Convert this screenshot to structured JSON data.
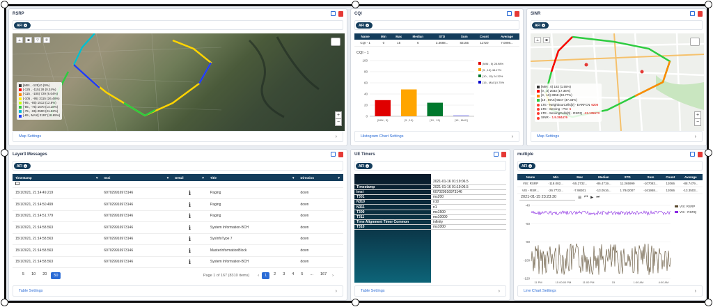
{
  "rsrp": {
    "title": "RSRP",
    "afi": "AFI",
    "legend": [
      {
        "label": "[MIN , -125) 0 (0%)",
        "color": "#333333"
      },
      {
        "label": "[-125 , -115) 28 (0.24%)",
        "color": "#ff0000"
      },
      {
        "label": "[-115 , -105) 729 (6.04%)",
        "color": "#ff8a00"
      },
      {
        "label": "[-105 , -95) 3115 (26.48%)",
        "color": "#ffee00"
      },
      {
        "label": "[-95 , -85) 1512 (12.8%)",
        "color": "#c8ff00"
      },
      {
        "label": "[-85 , -75) 1670 (14.18%)",
        "color": "#2ecc40"
      },
      {
        "label": "[-75 , -65) 2500 (21.22%)",
        "color": "#00bcd4"
      },
      {
        "label": "[-65 , MAX] 2197 (18.65%)",
        "color": "#1e3cff"
      }
    ],
    "footer": "Map Settings"
  },
  "cqi": {
    "title": "CQI",
    "afi": "AFI",
    "stats_headers": [
      "Name",
      "Min",
      "Max",
      "Median",
      "STD",
      "Sum",
      "Count",
      "Average"
    ],
    "stats_rows": [
      [
        "CQI - 1",
        "0",
        "15",
        "6",
        "3.3688...",
        "82155",
        "11720",
        "7.0098..."
      ]
    ],
    "chart_title": "CQI - 1",
    "footer": "Histogram Chart Settings"
  },
  "chart_data": {
    "type": "bar",
    "categories": [
      "[MIN , 5)",
      "[5 , 10)",
      "[10 , 15)",
      "[15 , MAX]"
    ],
    "values": [
      28.98,
      48.17,
      24.32,
      0.75
    ],
    "ylim": [
      0,
      100
    ],
    "yticks": [
      0,
      20,
      40,
      60,
      80,
      100
    ],
    "colors": [
      "#e00000",
      "#ffa500",
      "#00782d",
      "#0000cc"
    ],
    "legend": [
      "[MIN , 5) 28.98%",
      "[5 , 10) 48.17%",
      "[10 , 15) 24.32%",
      "[15 , MAX] 0.75%"
    ],
    "legend_position": "top-right"
  },
  "sinr": {
    "title": "SINR",
    "afi": "AFI",
    "legend": [
      {
        "label": "[MIN , 0) 182 (1.55%)",
        "color": "#333333"
      },
      {
        "label": "[0 , 3) 2033 (17.35%)",
        "color": "#ff0000"
      },
      {
        "label": "[3 , 10) 3958 (33.77%)",
        "color": "#ff8a00"
      },
      {
        "label": "[10 , MAX] 5547 (47.33%)",
        "color": "#2ecc40"
      }
    ],
    "info": [
      {
        "label": "LTE - NeighbourCells[0] - EARFCN",
        "value": "6200",
        "color": "#ff3b30"
      },
      {
        "label": "LTE - Serving - PCI",
        "value": "5",
        "color": "#ff3b30"
      },
      {
        "label": "LTE - ServingCells[0] - RSRQ",
        "value": "-13.135573",
        "color": "#ff3b30"
      },
      {
        "label": "SINR -",
        "value": "1.9.384476",
        "color": "#ff3b30"
      }
    ],
    "footer": "Map Settings"
  },
  "layer3": {
    "title": "Layer3 Messages",
    "afi": "AFI",
    "headers": [
      "Timestamp",
      "Imsi",
      "Detail",
      "Title",
      "Direction"
    ],
    "rows": [
      [
        "15/1/2021, 21:14:49.219",
        "607029916973146",
        "i",
        "Paging",
        "down"
      ],
      [
        "15/1/2021, 21:14:50.499",
        "607029916973146",
        "i",
        "Paging",
        "down"
      ],
      [
        "15/1/2021, 21:14:51.779",
        "607029916973146",
        "i",
        "Paging",
        "down"
      ],
      [
        "15/1/2021, 21:14:58.563",
        "607029916973146",
        "i",
        "System Information-BCH",
        "down"
      ],
      [
        "15/1/2021, 21:14:58.563",
        "607029916973146",
        "i",
        "SysInfoType 7",
        "down"
      ],
      [
        "15/1/2021, 21:14:58.563",
        "607029916973146",
        "i",
        "MasterInformationBlock",
        "down"
      ],
      [
        "15/1/2021, 21:14:58.563",
        "607029916973146",
        "i",
        "System Information-BCH",
        "down"
      ]
    ],
    "page_sizes": [
      "5",
      "10",
      "20",
      "50"
    ],
    "page_size_selected": "50",
    "page_info": "Page 1 of 167 (8310 items)",
    "pages": [
      "1",
      "2",
      "3",
      "4",
      "5",
      "...",
      "167"
    ],
    "footer": "Table Settings"
  },
  "ue_timers": {
    "title": "UE Timers",
    "afi": "AFI",
    "rows": [
      [
        "",
        "2021-01-16 01:19:06.5"
      ],
      [
        "Timestamp",
        "2021-01-16 01:19:06.5"
      ],
      [
        "Imsi",
        "607029916973146"
      ],
      [
        "T301",
        "ms200"
      ],
      [
        "N310",
        "n10"
      ],
      [
        "N311",
        "n1"
      ],
      [
        "T300",
        "ms1500"
      ],
      [
        "T311",
        "ms10000"
      ],
      [
        "Time Alignment Timer Common",
        "infinity"
      ],
      [
        "T310",
        "ms1000"
      ]
    ],
    "footer": "Table Settings"
  },
  "multiple": {
    "title": "multiple",
    "afi": "AFI",
    "stats_headers": [
      "Name",
      "Min",
      "Max",
      "Median",
      "STD",
      "Sum",
      "Count",
      "Average"
    ],
    "stats_rows": [
      [
        "VIS: RSRP",
        "-118.082...",
        "-55.2732...",
        "-86.4719...",
        "11.265999",
        "-107083...",
        "12066",
        "-88.7479..."
      ],
      [
        "VIS - RSR...",
        "-26.7733...",
        "-7.98301",
        "-13.0516...",
        "1.7842007",
        "-161958...",
        "12066",
        "-13.3503..."
      ]
    ],
    "time_value": "2021-01-15 23:23:30",
    "legend": [
      "VIS: RSRP",
      "VIS - RSRQ"
    ],
    "series_colors": [
      "#5a4a2e",
      "#8a2be2"
    ],
    "y_ticks": [
      "-40",
      "-60",
      "-80",
      "-100",
      "-120"
    ],
    "x_ticks": [
      "11 PM",
      "15 00:00 PM",
      "11:00 PM",
      "15",
      "1:00 AM",
      "4:00 AM"
    ],
    "footer": "Line Chart Settings"
  }
}
